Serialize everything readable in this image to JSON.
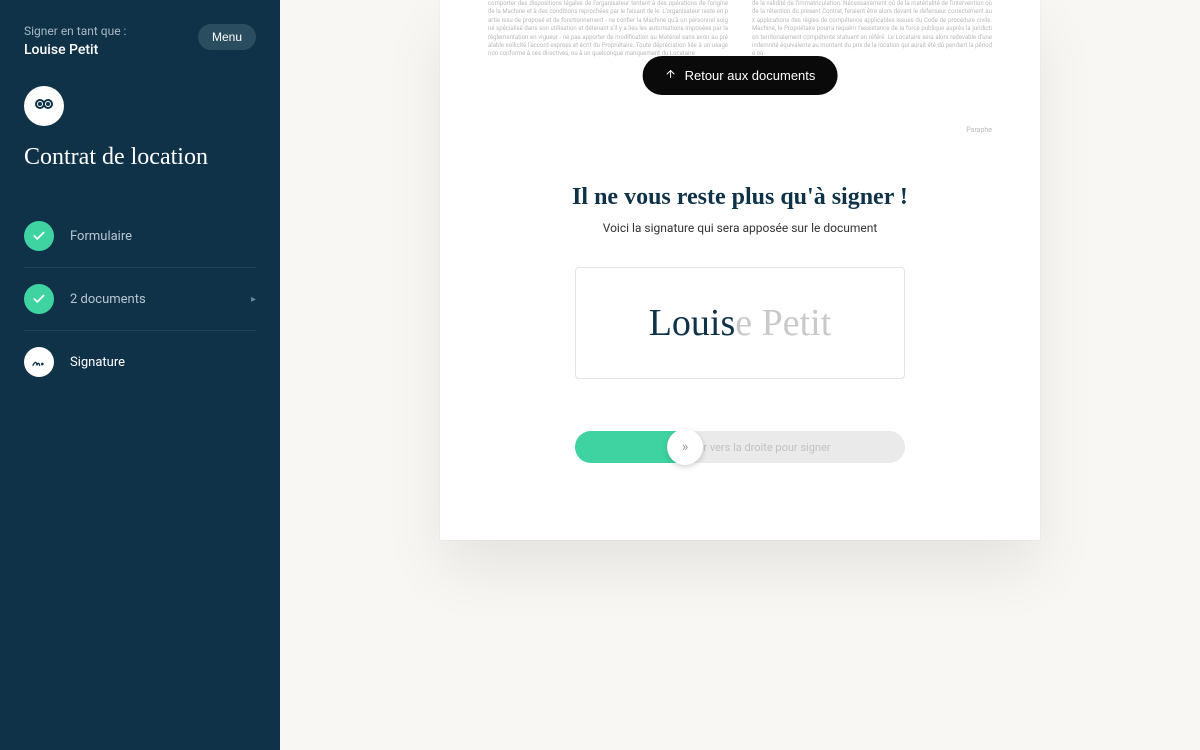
{
  "sidebar": {
    "sign_as_label": "Signer en tant que :",
    "user_name": "Louise Petit",
    "menu_label": "Menu",
    "title": "Contrat de location",
    "steps": [
      {
        "label": "Formulaire",
        "state": "done"
      },
      {
        "label": "2 documents",
        "state": "done",
        "has_chevron": true
      },
      {
        "label": "Signature",
        "state": "active"
      }
    ]
  },
  "main": {
    "return_button": "Retour aux documents",
    "doc_filler_1": "comporter des dispositions légales de l'organisateur tentant à des opérations de l'origine de la Machine et à des conditions reprochées par le faisant de le. L'organisateur reste en partie issu de proposé et de fonctionnement - ne confier la Machine qu'à un personnel soigné spécialisé dans son utilisation et détenant s'il y a lieu les autorisations imposées par la règlementation en vigueur - ne pas apporter de modification au Matériel sans avoir au préalable sollicité l'accord express et écrit du Propriétaire. Toute dépréciation liée à un usage non conforme à ces directives, ou à un quelconque manquement du Locataire",
    "doc_filler_2": "de la validité de l'immatriculation. Nécessairement où de la matérialité de l'intervention où de la rétention du present Contrat, feraient être alors devant le defenseur correctement aux applications des règles de compétence applicables issues du Code de procédure civile. Machine, le Propriétaire pourra requérir l'assistance de la force publique auprès la juridiction territorialement compétente statuant en référé. Le Locataire sera alors redevable d'une indemnité équivalente au montant du prix de la location qui aurait été dû pendant la période où",
    "paraphe_label": "Paraphe",
    "signature": {
      "heading": "Il ne vous reste plus qu'à signer !",
      "subtitle": "Voici la signature qui sera apposée sur le document",
      "name_dark": "Louis",
      "name_light": "e Petit",
      "slider_hint": "Slider vers la droite pour signer"
    }
  },
  "colors": {
    "sidebar_bg": "#0f3249",
    "accent_green": "#3fd3a1"
  }
}
